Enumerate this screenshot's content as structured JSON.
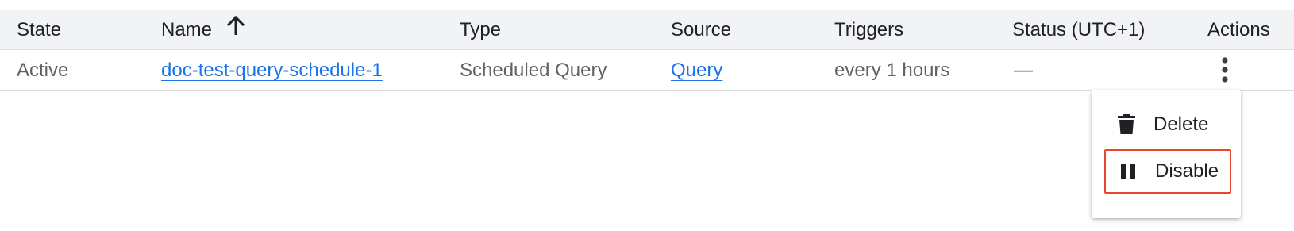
{
  "table": {
    "columns": [
      "State",
      "Name",
      "Type",
      "Source",
      "Triggers",
      "Status (UTC+1)",
      "Actions"
    ],
    "rows": [
      {
        "state": "Active",
        "name": "doc-test-query-schedule-1",
        "type": "Scheduled Query",
        "source": "Query",
        "triggers": "every 1 hours",
        "status": "—"
      }
    ],
    "sort_icon": "arrow-up-icon"
  },
  "actions_menu": {
    "items": [
      {
        "label": "Delete",
        "icon": "trash-icon"
      },
      {
        "label": "Disable",
        "icon": "pause-icon",
        "highlighted": true
      }
    ]
  },
  "colors": {
    "header_bg": "#f1f3f4",
    "link": "#1a73e8",
    "highlight_border": "#e8472a"
  }
}
